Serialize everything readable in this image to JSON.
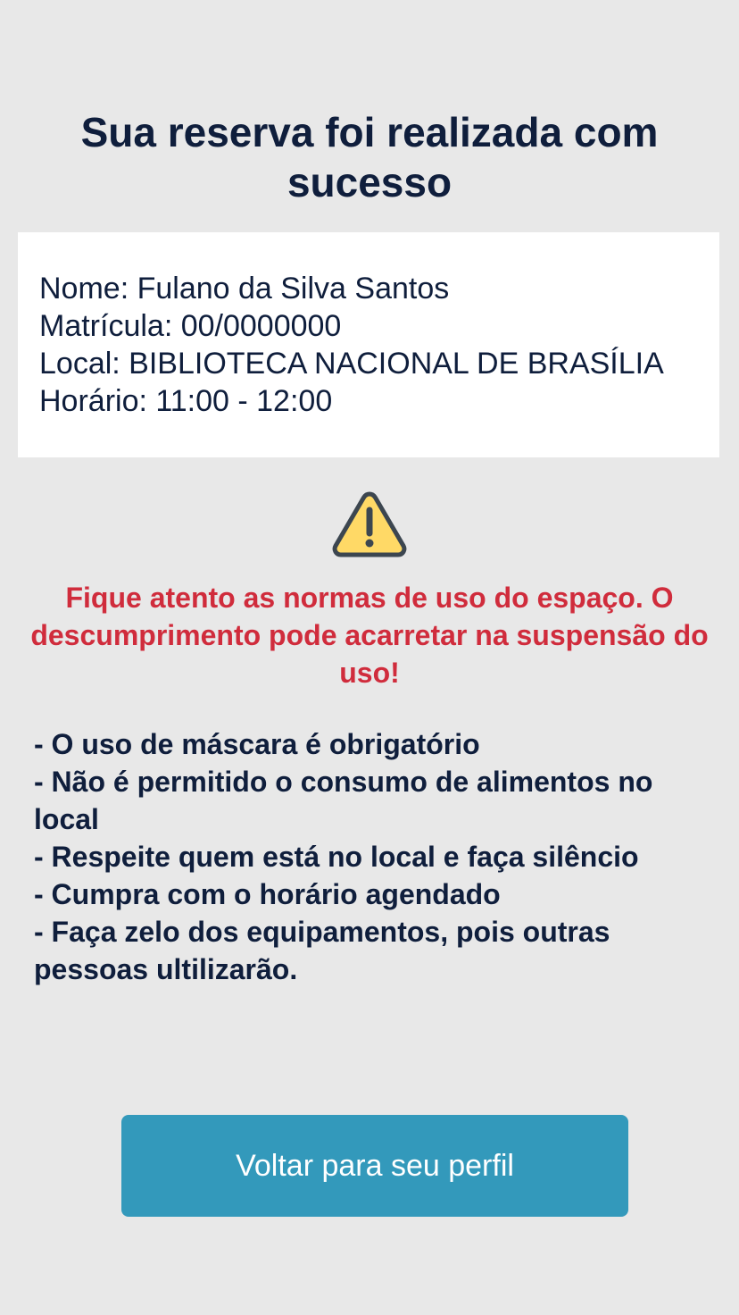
{
  "header": {
    "title": "Sua reserva foi realizada com sucesso"
  },
  "reservation": {
    "name_line": "Nome: Fulano da Silva Santos",
    "registration_line": "Matrícula: 00/0000000",
    "location_line": "Local: BIBLIOTECA NACIONAL DE BRASÍLIA",
    "time_line": "Horário: 11:00 - 12:00"
  },
  "warning": {
    "icon": "warning-triangle-icon",
    "message": "Fique atento as normas de uso do espaço. O descumprimento pode acarretar na suspensão do uso!"
  },
  "rules": {
    "items": [
      "- O uso de máscara é obrigatório",
      "- Não é permitido o consumo de alimentos no local",
      "- Respeite quem está no local e faça silêncio",
      "- Cumpra com o horário agendado",
      "- Faça zelo dos equipamentos, pois outras pessoas ultilizarão."
    ]
  },
  "actions": {
    "back_label": "Voltar para seu perfil"
  },
  "colors": {
    "background": "#e8e8e8",
    "text": "#0f1e3c",
    "warning_text": "#d02c3c",
    "button": "#3399bb",
    "button_text": "#ffffff",
    "warning_icon_fill": "#ffd966",
    "warning_icon_stroke": "#3c4650"
  }
}
